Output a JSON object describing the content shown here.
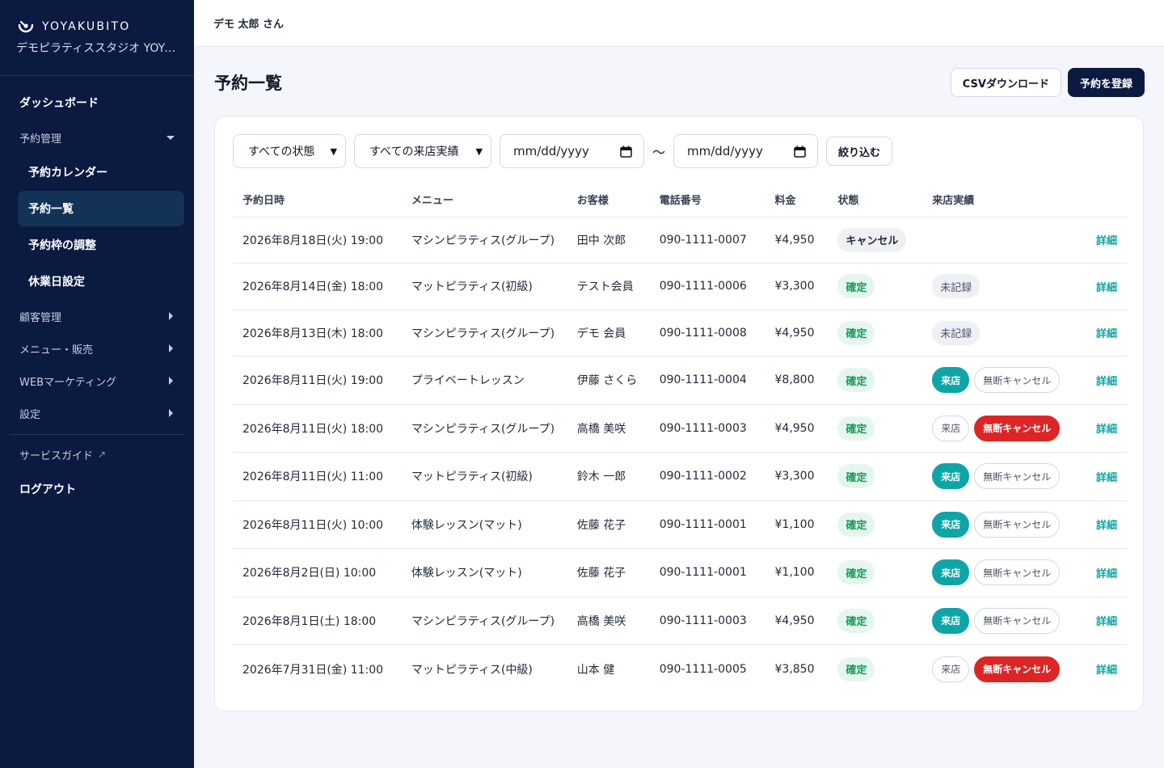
{
  "brand": {
    "name": "YOYAKUBITO",
    "studio": "デモピラティススタジオ YOYAKUBITO"
  },
  "sidebar": {
    "dashboard": "ダッシュボード",
    "reservation_group": "予約管理",
    "reservation_items": [
      "予約カレンダー",
      "予約一覧",
      "予約枠の調整",
      "休業日設定"
    ],
    "groups": [
      "顧客管理",
      "メニュー・販売",
      "WEBマーケティング",
      "設定"
    ],
    "service_guide": "サービスガイド",
    "logout": "ログアウト"
  },
  "topbar": {
    "user": "デモ 太郎 さん"
  },
  "page": {
    "title": "予約一覧",
    "csv_button": "CSVダウンロード",
    "register_button": "予約を登録"
  },
  "filters": {
    "status": "すべての状態",
    "visit": "すべての来店実績",
    "date_from": "mm/dd/yyyy",
    "range_sep": "〜",
    "date_to": "mm/dd/yyyy",
    "apply": "絞り込む"
  },
  "table": {
    "headers": [
      "予約日時",
      "メニュー",
      "お客様",
      "電話番号",
      "料金",
      "状態",
      "来店実績"
    ],
    "visit_label": "来店",
    "noshow_label": "無断キャンセル",
    "unrecorded_label": "未記録",
    "detail_label": "詳細",
    "rows": [
      {
        "date": "2026年8月18日(火) 19:00",
        "menu": "マシンピラティス(グループ)",
        "customer": "田中 次郎",
        "phone": "090-1111-0007",
        "price": "¥4,950",
        "status": "キャンセル"
      },
      {
        "date": "2026年8月14日(金) 18:00",
        "menu": "マットピラティス(初級)",
        "customer": "テスト会員",
        "phone": "090-1111-0006",
        "price": "¥3,300",
        "status": "確定"
      },
      {
        "date": "2026年8月13日(木) 18:00",
        "menu": "マシンピラティス(グループ)",
        "customer": "デモ 会員",
        "phone": "090-1111-0008",
        "price": "¥4,950",
        "status": "確定"
      },
      {
        "date": "2026年8月11日(火) 19:00",
        "menu": "プライベートレッスン",
        "customer": "伊藤 さくら",
        "phone": "090-1111-0004",
        "price": "¥8,800",
        "status": "確定"
      },
      {
        "date": "2026年8月11日(火) 18:00",
        "menu": "マシンピラティス(グループ)",
        "customer": "高橋 美咲",
        "phone": "090-1111-0003",
        "price": "¥4,950",
        "status": "確定"
      },
      {
        "date": "2026年8月11日(火) 11:00",
        "menu": "マットピラティス(初級)",
        "customer": "鈴木 一郎",
        "phone": "090-1111-0002",
        "price": "¥3,300",
        "status": "確定"
      },
      {
        "date": "2026年8月11日(火) 10:00",
        "menu": "体験レッスン(マット)",
        "customer": "佐藤 花子",
        "phone": "090-1111-0001",
        "price": "¥1,100",
        "status": "確定"
      },
      {
        "date": "2026年8月2日(日) 10:00",
        "menu": "体験レッスン(マット)",
        "customer": "佐藤 花子",
        "phone": "090-1111-0001",
        "price": "¥1,100",
        "status": "確定"
      },
      {
        "date": "2026年8月1日(土) 18:00",
        "menu": "マシンピラティス(グループ)",
        "customer": "高橋 美咲",
        "phone": "090-1111-0003",
        "price": "¥4,950",
        "status": "確定"
      },
      {
        "date": "2026年7月31日(金) 11:00",
        "menu": "マットピラティス(中級)",
        "customer": "山本 健",
        "phone": "090-1111-0005",
        "price": "¥3,850",
        "status": "確定"
      }
    ]
  },
  "colors": {
    "sidebar_bg": "#0b1a40",
    "accent_teal": "#0ea5a6",
    "danger_red": "#dc2626",
    "confirm_green": "#0f9d58"
  }
}
